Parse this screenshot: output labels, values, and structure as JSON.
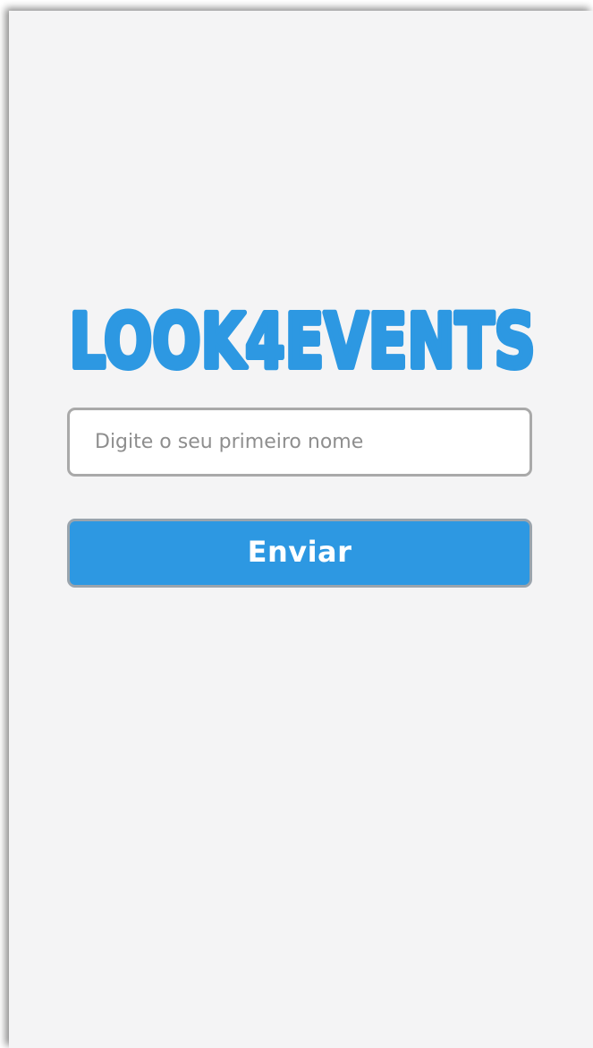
{
  "app": {
    "logo_text": "LOOK4EVENTS",
    "accent_color": "#2d98e2",
    "background_color": "#f4f4f5"
  },
  "form": {
    "name_placeholder": "Digite o seu primeiro nome",
    "name_value": "",
    "submit_label": "Enviar"
  }
}
